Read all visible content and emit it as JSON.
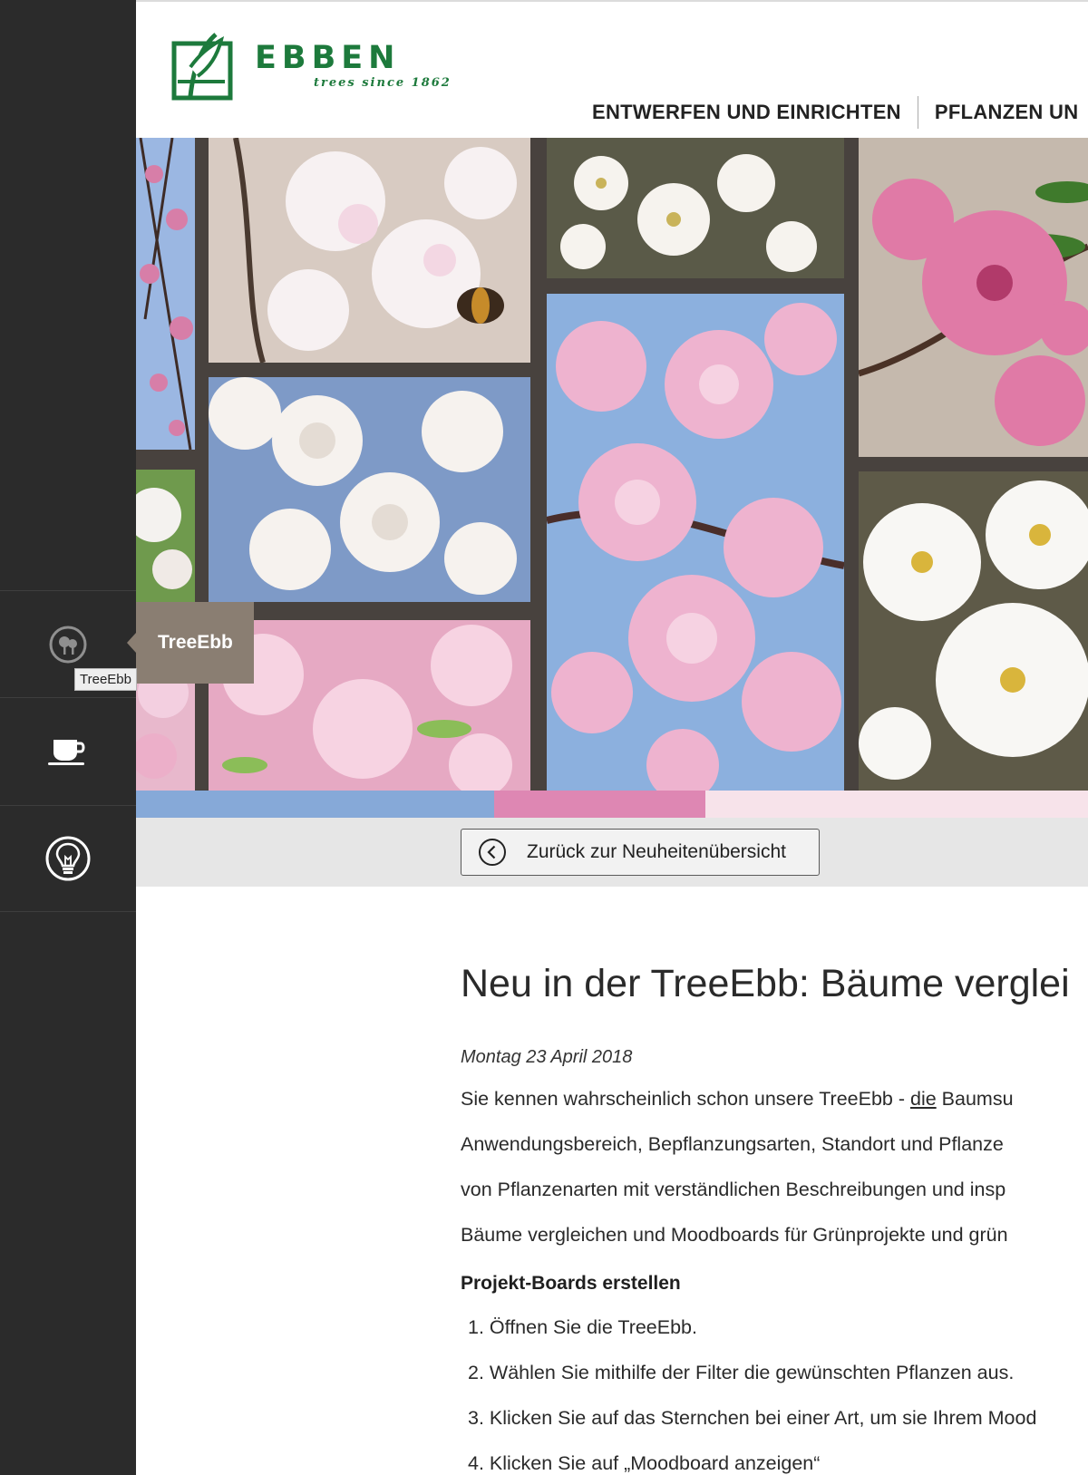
{
  "brand": {
    "name": "EBBEN",
    "tagline": "trees since 1862",
    "green": "#1d7a3c"
  },
  "nav": {
    "items": [
      "ENTWERFEN UND EINRICHTEN",
      "PFLANZEN UN"
    ]
  },
  "sidebar": {
    "items": [
      {
        "icon": "tree-icon",
        "label": "TreeEbb"
      },
      {
        "icon": "coffee-cup-icon",
        "label": ""
      },
      {
        "icon": "lightbulb-icon",
        "label": ""
      }
    ],
    "flyout_label": "TreeEbb",
    "tooltip": "TreeEbb"
  },
  "collage": {
    "frame_color": "#48423e",
    "color_bar": [
      "#86a9d8",
      "#de87b3",
      "#f7e3ea"
    ]
  },
  "back_button": {
    "label": "Zurück zur Neuheitenübersicht",
    "icon": "chevron-left-circle-icon"
  },
  "article": {
    "title": "Neu in der TreeEbb: Bäume verglei",
    "date": "Montag 23 April 2018",
    "lines": [
      {
        "before": "Sie kennen wahrscheinlich schon unsere TreeEbb - ",
        "link": "die",
        "after": " Baumsu"
      },
      {
        "text": "Anwendungsbereich, Bepflanzungsarten, Standort und Pflanze"
      },
      {
        "text": "von Pflanzenarten mit verständlichen Beschreibungen und insp"
      },
      {
        "text": "Bäume vergleichen und Moodboards für Grünprojekte und grün"
      }
    ],
    "subheading": "Projekt-Boards erstellen",
    "steps": [
      "1. Öffnen Sie die TreeEbb.",
      "2. Wählen Sie mithilfe der Filter die gewünschten Pflanzen aus.",
      "3. Klicken Sie auf das Sternchen bei einer Art, um sie Ihrem Mood",
      "4. Klicken Sie auf „Moodboard anzeigen“"
    ]
  }
}
